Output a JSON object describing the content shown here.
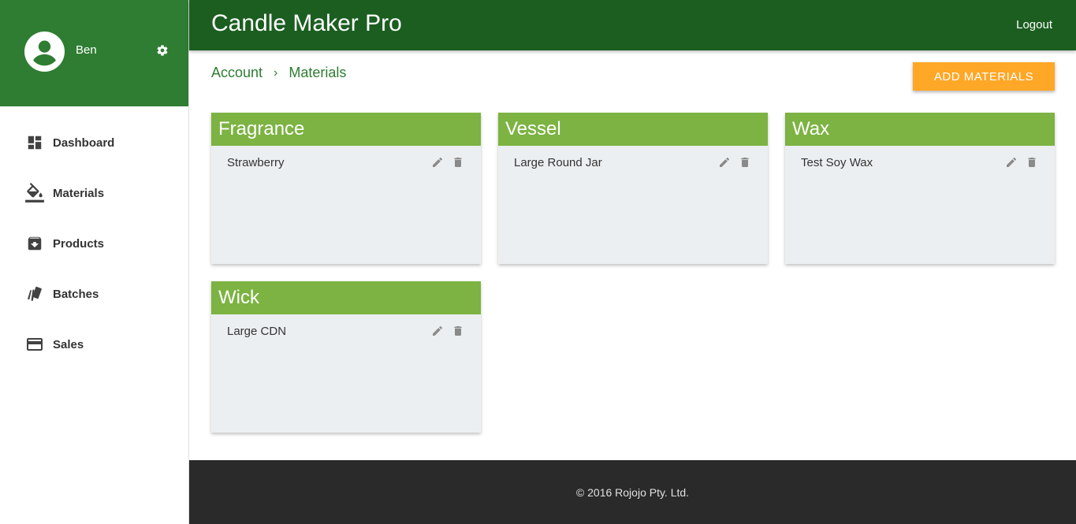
{
  "app": {
    "title": "Candle Maker Pro",
    "logout_label": "Logout"
  },
  "profile": {
    "name": "Ben"
  },
  "sidebar": {
    "items": [
      {
        "label": "Dashboard",
        "icon": "dashboard-icon"
      },
      {
        "label": "Materials",
        "icon": "paint-bucket-icon"
      },
      {
        "label": "Products",
        "icon": "archive-icon"
      },
      {
        "label": "Batches",
        "icon": "swatches-icon"
      },
      {
        "label": "Sales",
        "icon": "credit-card-icon"
      }
    ]
  },
  "breadcrumb": {
    "items": [
      "Account",
      "Materials"
    ]
  },
  "toolbar": {
    "add_label": "ADD MATERIALS"
  },
  "cards": [
    {
      "title": "Fragrance",
      "items": [
        "Strawberry"
      ]
    },
    {
      "title": "Vessel",
      "items": [
        "Large Round Jar"
      ]
    },
    {
      "title": "Wax",
      "items": [
        "Test Soy Wax"
      ]
    },
    {
      "title": "Wick",
      "items": [
        "Large CDN"
      ]
    }
  ],
  "footer": {
    "text": "© 2016 Rojojo Pty. Ltd."
  },
  "colors": {
    "primary": "#2e7d32",
    "primary_dark": "#1b5e20",
    "card_header": "#7cb342",
    "accent": "#ffa726",
    "footer": "#2b2a2a"
  }
}
